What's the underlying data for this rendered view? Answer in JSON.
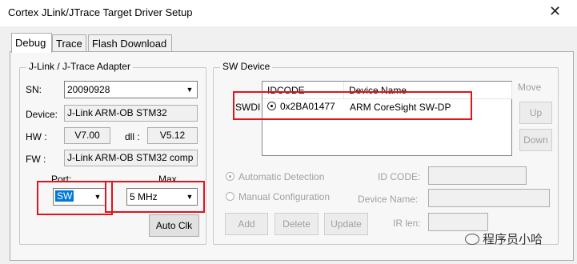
{
  "window": {
    "title": "Cortex JLink/JTrace Target Driver Setup",
    "close_glyph": "✕"
  },
  "tabs": [
    {
      "label": "Debug"
    },
    {
      "label": "Trace"
    },
    {
      "label": "Flash Download"
    }
  ],
  "jlink": {
    "legend": "J-Link / J-Trace Adapter",
    "sn_label": "SN:",
    "sn_value": "20090928",
    "device_label": "Device:",
    "device_value": "J-Link ARM-OB STM32",
    "hw_label": "HW :",
    "hw_value": "V7.00",
    "dll_label": "dll :",
    "dll_value": "V5.12",
    "fw_label": "FW :",
    "fw_value": "J-Link ARM-OB STM32 comp",
    "port_label": "Port:",
    "port_value": "SW",
    "max_label": "Max",
    "max_value": "5 MHz",
    "autoclk_label": "Auto Clk"
  },
  "swdevice": {
    "legend": "SW Device",
    "col_idcode": "IDCODE",
    "col_devname": "Device Name",
    "row_label": "SWDI",
    "row_idcode": "0x2BA01477",
    "row_devname": "ARM CoreSight SW-DP",
    "move_label": "Move",
    "up_label": "Up",
    "down_label": "Down",
    "auto_detect_label": "Automatic Detection",
    "manual_config_label": "Manual Configuration",
    "idcode_label": "ID CODE:",
    "devname_label": "Device Name:",
    "irlen_label": "IR len:",
    "add_label": "Add",
    "delete_label": "Delete",
    "update_label": "Update"
  },
  "watermark": {
    "text": "程序员小哈"
  },
  "colors": {
    "highlight_box": "#e0141e",
    "selection": "#0078d7"
  }
}
